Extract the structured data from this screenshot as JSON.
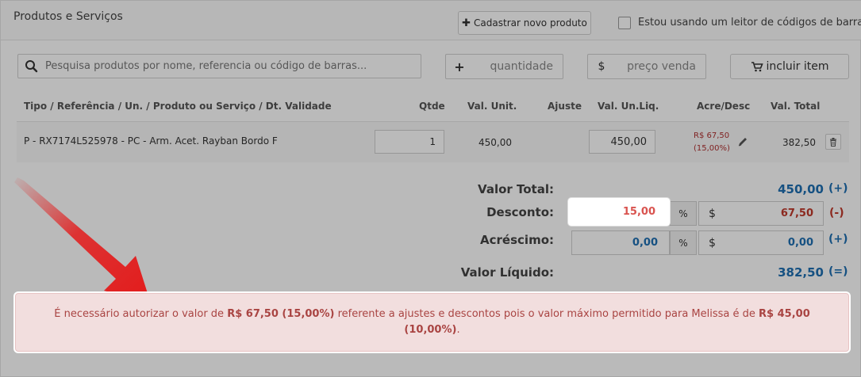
{
  "panel": {
    "title": "Produtos e Serviços",
    "new_product_button": "Cadastrar novo produto",
    "barcode_checkbox_label": "Estou usando um leitor de códigos de barras"
  },
  "search": {
    "placeholder": "Pesquisa produtos por nome, referencia ou código de barras..."
  },
  "quantity": {
    "prefix": "+",
    "placeholder": "quantidade"
  },
  "price": {
    "prefix": "$",
    "placeholder": "preço venda"
  },
  "include_button": "incluir item",
  "table": {
    "headers": {
      "description": "Tipo / Referência / Un. / Produto ou Serviço / Dt. Validade",
      "qty": "Qtde",
      "unit_price": "Val. Unit.",
      "adjust": "Ajuste",
      "net_unit": "Val. Un.Liq.",
      "acre_desc": "Acre/Desc",
      "total": "Val. Total"
    },
    "rows": [
      {
        "description": "P - RX7174L525978 - PC - Arm. Acet. Rayban Bordo F",
        "qty": "1",
        "unit_price": "450,00",
        "net_unit": "450,00",
        "adjust_value": "R$ 67,50",
        "adjust_pct": "(15,00%)",
        "total": "382,50"
      }
    ]
  },
  "summary": {
    "total_label": "Valor Total:",
    "total_value": "450,00",
    "total_sign": "(+)",
    "discount_label": "Desconto:",
    "discount_pct": "15,00",
    "discount_value": "67,50",
    "discount_sign": "(-)",
    "addition_label": "Acréscimo:",
    "addition_pct": "0,00",
    "addition_value": "0,00",
    "addition_sign": "(+)",
    "net_label": "Valor Líquido:",
    "net_value": "382,50",
    "net_sign": "(=)",
    "pct_symbol": "%",
    "currency_symbol": "$"
  },
  "alert": {
    "part1": "É necessário autorizar o valor de ",
    "amount": "R$ 67,50 (15,00%)",
    "part2": " referente a ajustes e descontos pois o valor máximo permitido para Melissa é de ",
    "limit_amount": "R$ 45,00",
    "limit_pct": "(10,00%)",
    "end": "."
  },
  "colors": {
    "alert_text": "#a94442",
    "alert_bg": "#f2dede",
    "value_blue": "#1f6fb2",
    "discount_red": "#c0392b",
    "arrow_red": "#e31b1b"
  }
}
